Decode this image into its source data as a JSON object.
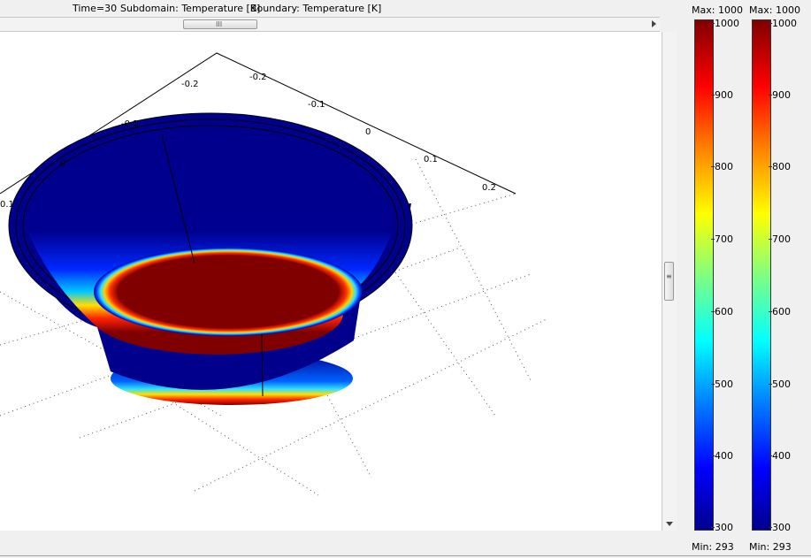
{
  "header": {
    "time_label": "Time=30",
    "subdomain_label": "Subdomain: Temperature [K]",
    "boundary_label": "Boundary: Temperature [K]"
  },
  "axes": {
    "left_ticks": [
      "-0.2",
      "-0.1",
      "0",
      "0.1"
    ],
    "right_ticks": [
      "-0.2",
      "-0.1",
      "0",
      "0.1",
      "0.2"
    ]
  },
  "colorbars": [
    {
      "max_label": "Max: 1000",
      "min_label": "Min: 293",
      "ticks": [
        "1000",
        "900",
        "800",
        "700",
        "600",
        "500",
        "400",
        "300"
      ]
    },
    {
      "max_label": "Max: 1000",
      "min_label": "Min: 293",
      "ticks": [
        "1000",
        "900",
        "800",
        "700",
        "600",
        "500",
        "400",
        "300"
      ]
    }
  ],
  "colors": {
    "cold": "#00008c",
    "hot": "#800000"
  },
  "scroll": {
    "horizontal_grip": "III",
    "vertical_grip": "≡"
  }
}
